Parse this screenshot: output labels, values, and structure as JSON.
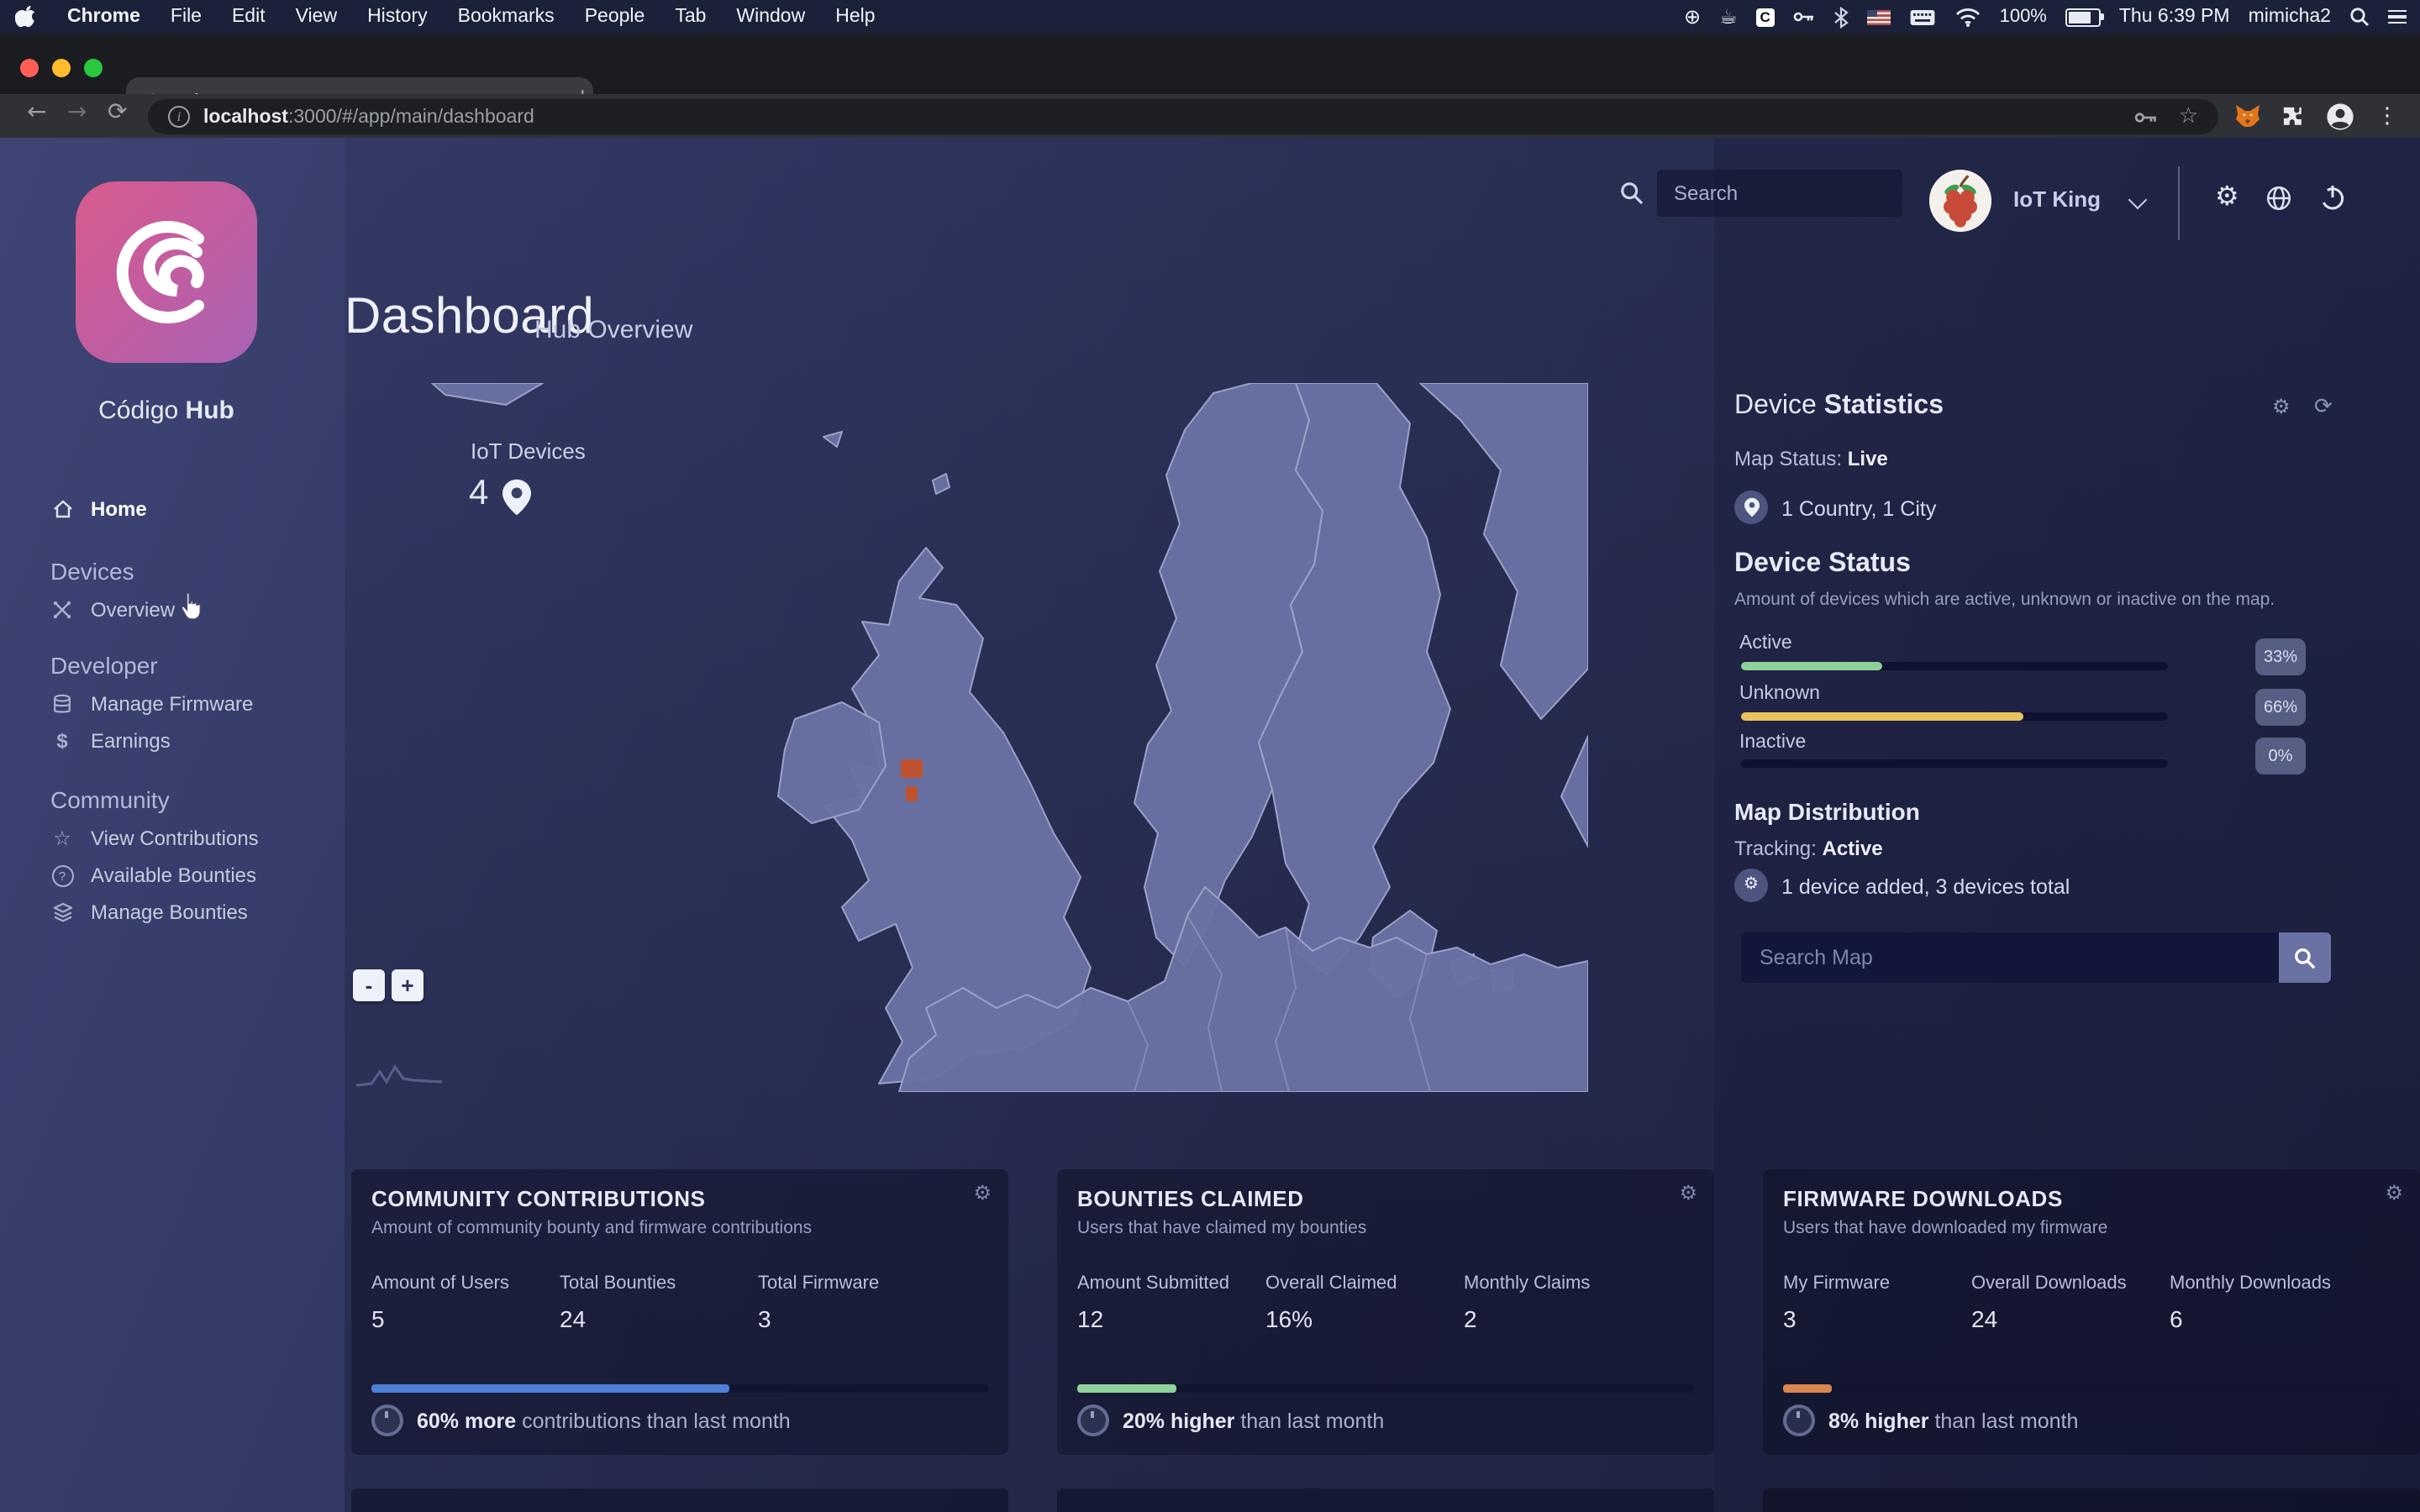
{
  "menu_bar": {
    "items": [
      "Chrome",
      "File",
      "Edit",
      "View",
      "History",
      "Bookmarks",
      "People",
      "Tab",
      "Window",
      "Help"
    ],
    "status": {
      "battery": "100%",
      "clock": "Thu 6:39 PM",
      "user": "mimicha2"
    },
    "icons": [
      "apple-icon",
      "screen-circle-icon",
      "hand-icon",
      "c-app-icon",
      "keychain-icon",
      "bluetooth-icon",
      "flag-icon",
      "keyboard-icon",
      "wifi-icon",
      "battery-icon",
      "spotlight-icon",
      "notification-list-icon"
    ]
  },
  "browser": {
    "tab_title": "Código Hub",
    "close": "×",
    "new_tab": "+",
    "back": "←",
    "forward": "→",
    "reload": "⟳",
    "url_host": "localhost",
    "url_rest": ":3000/#/app/main/dashboard",
    "bookmark_star": "☆",
    "more": "⋮"
  },
  "sidebar": {
    "brand_regular": "Código ",
    "brand_bold": "Hub",
    "home": "Home",
    "sections": [
      {
        "header": "Devices",
        "items": [
          {
            "label": "Overview"
          }
        ]
      },
      {
        "header": "Developer",
        "items": [
          {
            "label": "Manage Firmware"
          },
          {
            "label": "Earnings"
          }
        ]
      },
      {
        "header": "Community",
        "items": [
          {
            "label": "View Contributions"
          },
          {
            "label": "Available Bounties"
          },
          {
            "label": "Manage Bounties"
          }
        ]
      }
    ]
  },
  "topbar": {
    "search_placeholder": "Search",
    "user": "IoT King"
  },
  "page": {
    "title": "Dashboard",
    "subtitle": "Hub Overview"
  },
  "map": {
    "tooltip_label": "IoT Devices",
    "tooltip_count": "4",
    "zoom_out": "-",
    "zoom_in": "+"
  },
  "stats_panel": {
    "title_regular": "Device ",
    "title_bold": "Statistics",
    "settings_icon": "⚙",
    "refresh_icon": "⟳",
    "map_status_label": "Map Status: ",
    "map_status_value": "Live",
    "location_text": "1 Country, 1 City",
    "device_status_title": "Device Status",
    "device_status_desc": "Amount of devices which are active, unknown or inactive on the map.",
    "bars": [
      {
        "label": "Active",
        "pct": "33%",
        "value": 33,
        "color": "#8fd19a"
      },
      {
        "label": "Unknown",
        "pct": "66%",
        "value": 66,
        "color": "#e9c25e"
      },
      {
        "label": "Inactive",
        "pct": "0%",
        "value": 0,
        "color": "#8fd19a"
      }
    ],
    "map_dist_title": "Map Distribution",
    "tracking_label": "Tracking: ",
    "tracking_value": "Active",
    "note": "1 device added, 3 devices total",
    "search_placeholder": "Search Map"
  },
  "cards": [
    {
      "title": "COMMUNITY CONTRIBUTIONS",
      "subtitle": "Amount of community bounty and firmware contributions",
      "gear": "⚙",
      "stats": [
        {
          "label": "Amount of Users",
          "value": "5"
        },
        {
          "label": "Total Bounties",
          "value": "24"
        },
        {
          "label": "Total Firmware",
          "value": "3"
        }
      ],
      "progress": {
        "value": 58,
        "color": "#4d7fd6"
      },
      "footer_bold": "60% more",
      "footer_rest": " contributions than last month"
    },
    {
      "title": "BOUNTIES CLAIMED",
      "subtitle": "Users that have claimed my bounties",
      "gear": "⚙",
      "stats": [
        {
          "label": "Amount Submitted",
          "value": "12"
        },
        {
          "label": "Overall Claimed",
          "value": "16%"
        },
        {
          "label": "Monthly Claims",
          "value": "2"
        }
      ],
      "progress": {
        "value": 16,
        "color": "#90d29b"
      },
      "footer_bold": "20% higher",
      "footer_rest": " than last month"
    },
    {
      "title": "FIRMWARE DOWNLOADS",
      "subtitle": "Users that have downloaded my firmware",
      "gear": "⚙",
      "stats": [
        {
          "label": "My Firmware",
          "value": "3"
        },
        {
          "label": "Overall Downloads",
          "value": "24"
        },
        {
          "label": "Monthly Downloads",
          "value": "6"
        }
      ],
      "progress": {
        "value": 8,
        "color": "#d9854f"
      },
      "footer_bold": "8% higher",
      "footer_rest": " than last month"
    }
  ],
  "colors": {
    "accent_pink": "#d85c8c",
    "bar_active": "#8fd19a",
    "bar_unknown": "#e9c25e",
    "progress_blue": "#4d7fd6",
    "progress_green": "#90d29b",
    "progress_orange": "#d9854f",
    "map_marker_red": "#c0532f",
    "map_land": "#6a71a3"
  }
}
